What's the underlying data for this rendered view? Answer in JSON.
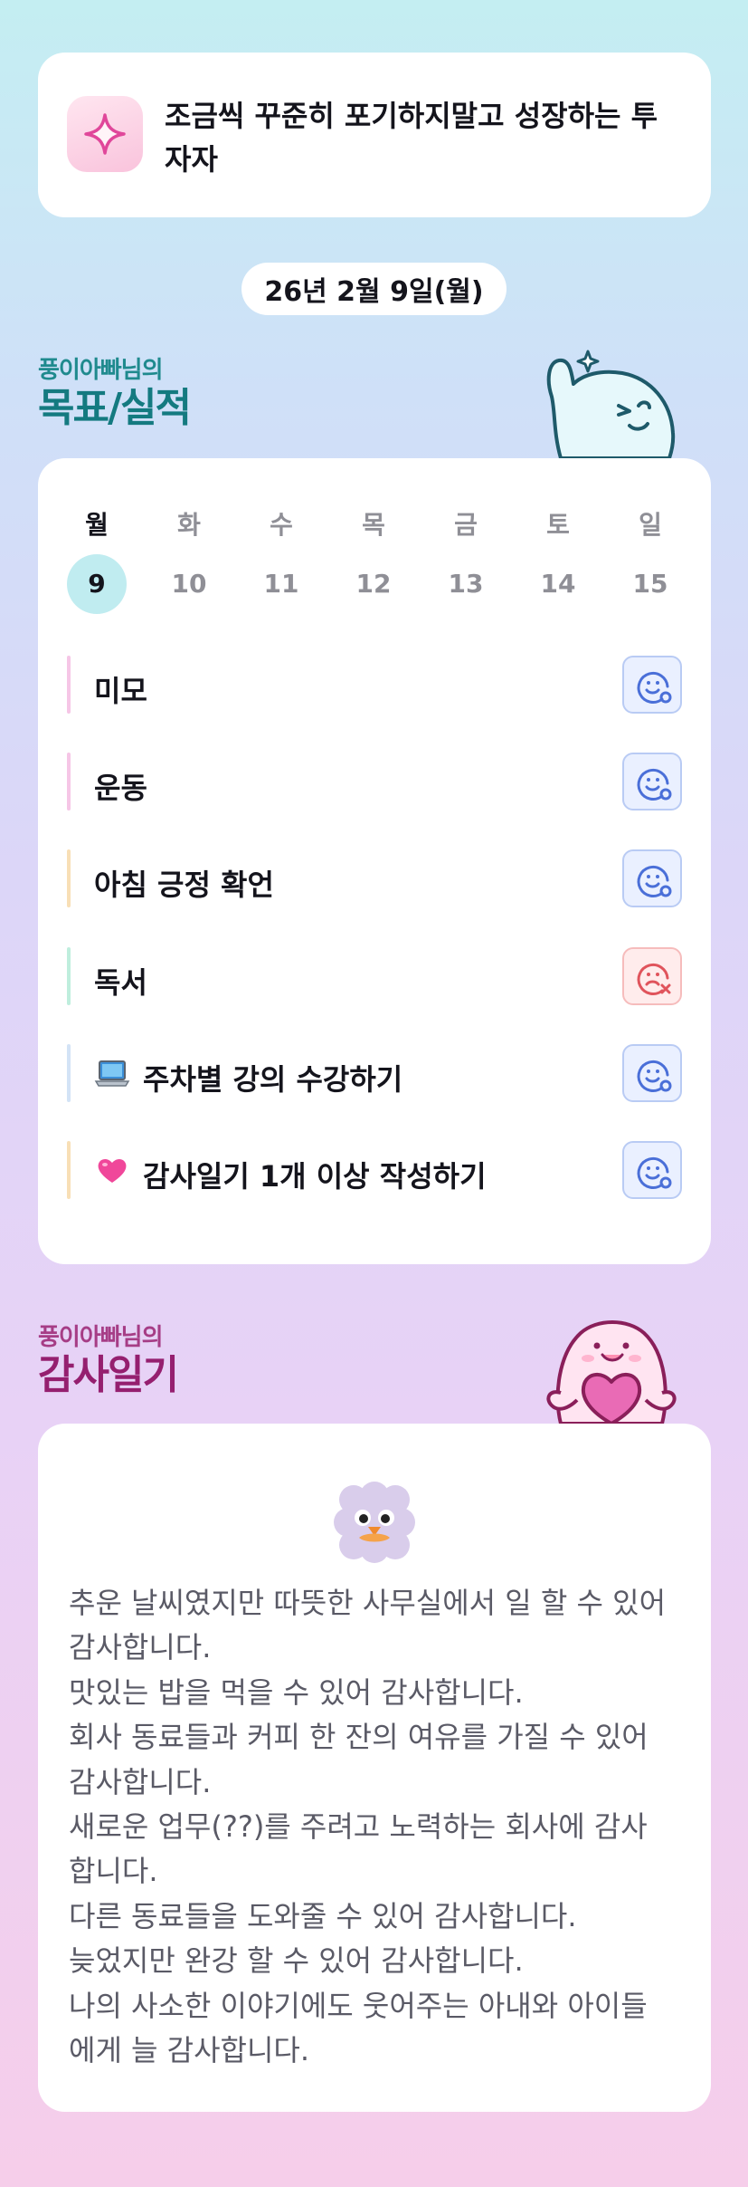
{
  "motto": {
    "icon": "sparkle-icon",
    "line1": "조금씩 꾸준히 포기하지말고 성장하는 투",
    "line2": "자자"
  },
  "date_label": "26년 2월 9일(월)",
  "goals": {
    "subtitle": "풍이아빠님의",
    "title": "목표/실적",
    "week": [
      {
        "day": "월",
        "num": "9",
        "active": true
      },
      {
        "day": "화",
        "num": "10"
      },
      {
        "day": "수",
        "num": "11"
      },
      {
        "day": "목",
        "num": "12"
      },
      {
        "day": "금",
        "num": "13"
      },
      {
        "day": "토",
        "num": "14"
      },
      {
        "day": "일",
        "num": "15"
      }
    ],
    "items": [
      {
        "label": "미모",
        "bar_color": "#f6c6e6",
        "status": "done"
      },
      {
        "label": "운동",
        "bar_color": "#f6c6e6",
        "status": "done"
      },
      {
        "label": "아침 긍정 확언",
        "bar_color": "#f8dfb6",
        "status": "done"
      },
      {
        "label": "독서",
        "bar_color": "#bfeedd",
        "status": "failed"
      },
      {
        "label": "주차별 강의 수강하기",
        "emoji": "laptop-icon",
        "bar_color": "#d3e3f6",
        "status": "done"
      },
      {
        "label": "감사일기 1개 이상 작성하기",
        "emoji": "heart-icon",
        "bar_color": "#f8dfb6",
        "status": "done"
      }
    ],
    "colors": {
      "done": "#4a6fd8",
      "failed": "#e0545c",
      "active_day": "#c0ecf0"
    }
  },
  "diary": {
    "subtitle": "풍이아빠님의",
    "title": "감사일기",
    "sticker": "fluffy-cloud-bird-sticker",
    "lines": [
      "추운 날씨였지만 따뜻한 사무실에서 일 할 수 있어",
      "감사합니다.",
      "맛있는 밥을 먹을 수 있어 감사합니다.",
      "회사 동료들과 커피 한 잔의 여유를 가질 수 있어",
      "감사합니다.",
      "새로운 업무(??)를 주려고 노력하는 회사에 감사",
      "합니다.",
      "다른 동료들을 도와줄 수 있어 감사합니다.",
      "늦었지만 완강 할 수 있어 감사합니다.",
      "나의 사소한 이야기에도 웃어주는 아내와 아이들",
      "에게 늘 감사합니다."
    ]
  }
}
